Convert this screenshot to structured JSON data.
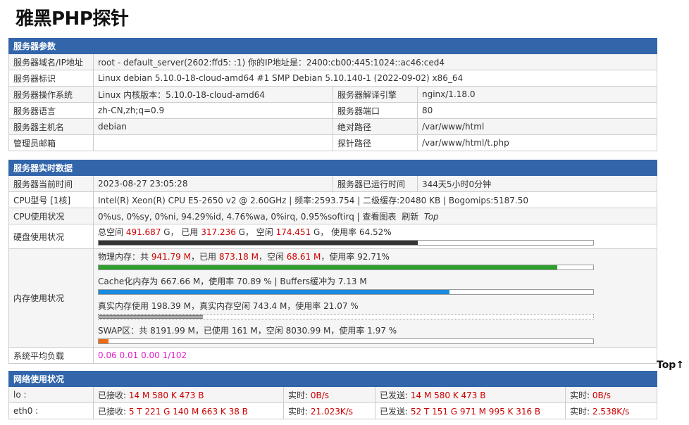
{
  "page_title": "雅黑PHP探针",
  "top_link": "Top↑",
  "server_params": {
    "header": "服务器参数",
    "domain_label": "服务器域名/IP地址",
    "domain_value": "root - default_server(2602:ffd5:        :1)  你的IP地址是：2400:cb00:445:1024::ac46:ced4",
    "id_label": "服务器标识",
    "id_value": "Linux debian 5.10.0-18-cloud-amd64 #1 SMP Debian 5.10.140-1 (2022-09-02) x86_64",
    "os_label": "服务器操作系统",
    "os_value": "Linux  内核版本：5.10.0-18-cloud-amd64",
    "engine_label": "服务器解译引擎",
    "engine_value": "nginx/1.18.0",
    "lang_label": "服务器语言",
    "lang_value": "zh-CN,zh;q=0.9",
    "port_label": "服务器端口",
    "port_value": "80",
    "host_label": "服务器主机名",
    "host_value": "debian",
    "abspath_label": "绝对路径",
    "abspath_value": "/var/www/html",
    "email_label": "管理员邮箱",
    "email_value": "",
    "probepath_label": "探针路径",
    "probepath_value": "/var/www/html/t.php"
  },
  "realtime": {
    "header": "服务器实时数据",
    "time_label": "服务器当前时间",
    "time_value": "2023-08-27 23:05:28",
    "uptime_label": "服务器已运行时间",
    "uptime_value": "344天5小时0分钟",
    "cpu_model_label": "CPU型号 [1核]",
    "cpu_model_value": "Intel(R) Xeon(R) CPU E5-2650 v2 @ 2.60GHz | 频率:2593.754 | 二级缓存:20480 KB | Bogomips:5187.50",
    "cpu_usage_label": "CPU使用状况",
    "cpu_usage_value": "0%us, 0%sy, 0%ni, 94.29%id, 4.76%wa, 0%irq, 0.95%softirq | ",
    "cpu_view_chart": "查看图表",
    "cpu_refresh": "刷新",
    "cpu_top": "Top",
    "disk_label": "硬盘使用状况",
    "disk": {
      "t1": "总空间 ",
      "total": "491.687",
      "t2": " G， 已用 ",
      "used": "317.236",
      "t3": " G， 空闲 ",
      "free": "174.451",
      "t4": " G， 使用率 ",
      "rate": "64.52%",
      "percent": 64.52
    },
    "memory_label": "内存使用状况",
    "mem_physical": {
      "t1": "物理内存：共 ",
      "total": "941.79 M",
      "t2": "，已用 ",
      "used": "873.18 M",
      "t3": "，空闲 ",
      "free": "68.61 M",
      "t4": "，使用率 ",
      "rate": "92.71%",
      "percent": 92.71
    },
    "mem_cache": {
      "text": "Cache化内存为 667.66 M，使用率 70.89 % | Buffers缓冲为 7.13 M",
      "percent": 70.89
    },
    "mem_real": {
      "text": "真实内存使用 198.39 M，真实内存空闲 743.4 M，使用率 21.07 %",
      "percent": 21.07
    },
    "mem_swap": {
      "text": "SWAP区：共 8191.99 M，已使用 161 M，空闲 8030.99 M，使用率 1.97 %",
      "percent": 1.97
    },
    "load_label": "系统平均负载",
    "load_value": "0.06 0.01 0.00 1/102"
  },
  "network": {
    "header": "网络使用状况",
    "recv_label": "已接收: ",
    "rt_label": "实时: ",
    "sent_label": "已发送: ",
    "interfaces": [
      {
        "name": "lo :",
        "recv": "14 M 580 K 473 B",
        "recv_rt": "0B/s",
        "sent": "14 M 580 K 473 B",
        "sent_rt": "0B/s"
      },
      {
        "name": "eth0 :",
        "recv": "5 T 221 G 140 M 663 K 38 B",
        "recv_rt": "21.023K/s",
        "sent": "52 T 151 G 971 M 995 K 316 B",
        "sent_rt": "2.538K/s"
      }
    ]
  },
  "colors": {
    "header_bg": "#3265aa",
    "accent_red": "#cc0000",
    "load_pink": "#e020c8",
    "bar_green": "#2ca02c",
    "bar_blue": "#1a8be0",
    "bar_orange": "#ee6a10",
    "bar_dark": "#333333"
  }
}
